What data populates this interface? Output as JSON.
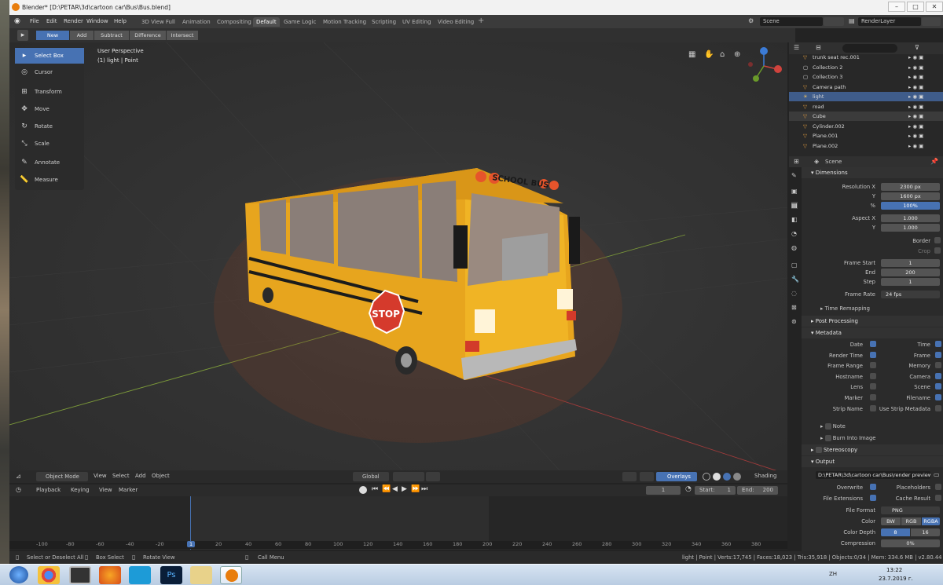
{
  "window": {
    "title": "Blender* [D:\\PETAR\\3d\\cartoon car\\Bus\\Bus.blend]"
  },
  "menu": [
    "File",
    "Edit",
    "Render",
    "Window",
    "Help"
  ],
  "workspaces": [
    "3D View Full",
    "Animation",
    "Compositing",
    "Default",
    "Game Logic",
    "Motion Tracking",
    "Scripting",
    "UV Editing",
    "Video Editing"
  ],
  "active_workspace": "Default",
  "scene_name": "Scene",
  "render_layer": "RenderLayer",
  "modes": [
    "New",
    "Add",
    "Subtract",
    "Difference",
    "Intersect"
  ],
  "tools": [
    "Select Box",
    "Cursor",
    "Transform",
    "Move",
    "Rotate",
    "Scale",
    "Annotate",
    "Measure"
  ],
  "viewport": {
    "persp": "User Perspective",
    "object_info": "(1) light | Point",
    "sign_text": "STOP",
    "bus_text": "SCHOOL BUS"
  },
  "vp_footer": {
    "mode": "Object Mode",
    "view": "View",
    "select": "Select",
    "add": "Add",
    "object": "Object",
    "global": "Global",
    "overlays": "Overlays",
    "shading": "Shading"
  },
  "timeline": {
    "playback": "Playback",
    "keying": "Keying",
    "view": "View",
    "marker": "Marker",
    "frame": "1",
    "start_label": "Start:",
    "start": "1",
    "end_label": "End:",
    "end": "200",
    "ticks": [
      "-100",
      "-80",
      "-60",
      "-40",
      "-20",
      "0",
      "20",
      "40",
      "60",
      "80",
      "100",
      "120",
      "140",
      "160",
      "180",
      "200",
      "220",
      "240",
      "260",
      "280",
      "300",
      "320",
      "340",
      "360",
      "380"
    ],
    "current_tick": "1"
  },
  "status": {
    "select": "Select or Deselect All",
    "box": "Box Select",
    "rotate": "Rotate View",
    "call": "Call Menu",
    "stats": "light | Point | Verts:17,745 | Faces:18,023 | Tris:35,918 | Objects:0/34 | Mem: 334.6 MB | v2.80.44"
  },
  "outliner": [
    {
      "name": "trunk seat rec.001",
      "kind": "obj"
    },
    {
      "name": "Collection 2",
      "kind": "col"
    },
    {
      "name": "Collection 3",
      "kind": "col"
    },
    {
      "name": "Camera path",
      "kind": "obj"
    },
    {
      "name": "light",
      "kind": "light",
      "sel": true
    },
    {
      "name": "road",
      "kind": "obj"
    },
    {
      "name": "Cube",
      "kind": "obj",
      "act": true
    },
    {
      "name": "Cylinder.002",
      "kind": "obj"
    },
    {
      "name": "Plane.001",
      "kind": "obj"
    },
    {
      "name": "Plane.002",
      "kind": "obj"
    }
  ],
  "props": {
    "scene": "Scene",
    "dimensions": "Dimensions",
    "res_x_label": "Resolution X",
    "res_x": "2300 px",
    "y_label": "Y",
    "res_y": "1600 px",
    "pct_label": "%",
    "pct": "100%",
    "aspect_x_label": "Aspect X",
    "aspect_x": "1.000",
    "aspect_y": "1.000",
    "border": "Border",
    "crop": "Crop",
    "frame_start_label": "Frame Start",
    "frame_start": "1",
    "end_label": "End",
    "end": "200",
    "step_label": "Step",
    "step": "1",
    "frame_rate_label": "Frame Rate",
    "frame_rate": "24 fps",
    "time_remap": "Time Remapping",
    "post": "Post Processing",
    "metadata": "Metadata",
    "meta_left": [
      "Date",
      "Render Time",
      "Frame Range",
      "Hostname",
      "Lens",
      "Marker",
      "Strip Name"
    ],
    "meta_left_on": [
      true,
      true,
      false,
      false,
      false,
      false,
      false
    ],
    "meta_right": [
      "Time",
      "Frame",
      "Memory",
      "Camera",
      "Scene",
      "Filename",
      "Use Strip Metadata"
    ],
    "meta_right_on": [
      true,
      true,
      false,
      true,
      true,
      true,
      false
    ],
    "note": "Note",
    "burn": "Burn Into Image",
    "stereo": "Stereoscopy",
    "output": "Output",
    "out_path": "D:\\PETAR\\3d\\cartoon car\\Bus\\render preview\\",
    "overwrite": "Overwrite",
    "placeholders": "Placeholders",
    "file_ext": "File Extensions",
    "cache": "Cache Result",
    "file_format_label": "File Format",
    "file_format": "PNG",
    "color_label": "Color",
    "color_opts": [
      "BW",
      "RGB",
      "RGBA"
    ],
    "depth_label": "Color Depth",
    "depth_opts": [
      "8",
      "16"
    ],
    "compression_label": "Compression",
    "compression": "0%"
  },
  "taskbar": {
    "lang": "ZH",
    "time": "13:22",
    "date": "23.7.2019 г."
  }
}
